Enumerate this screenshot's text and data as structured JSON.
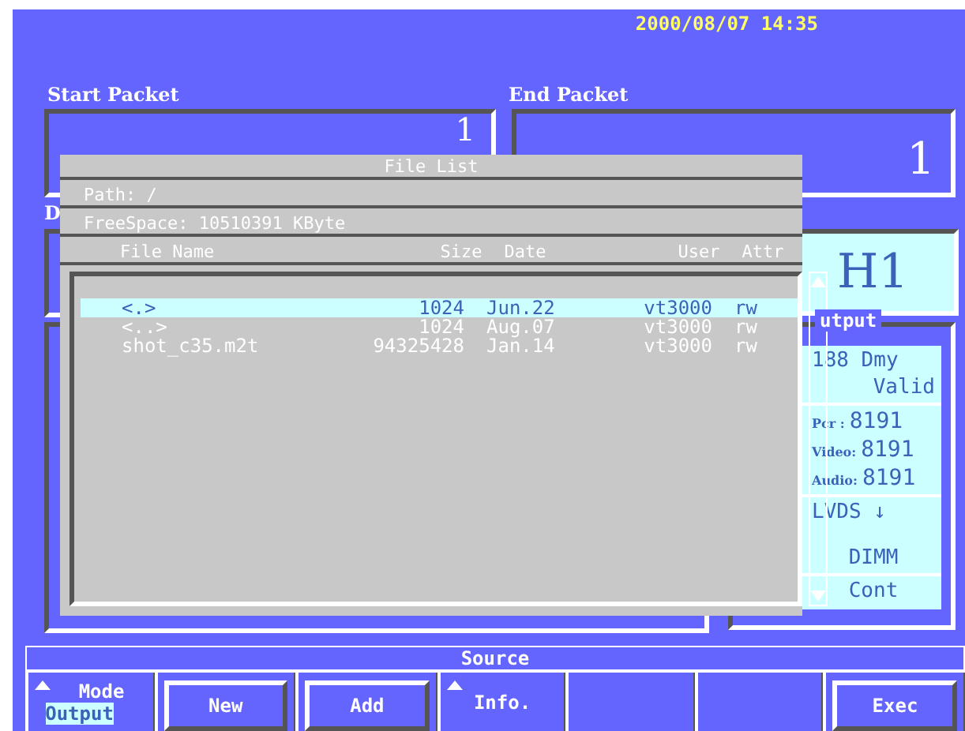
{
  "clock": "2000/08/07 14:35",
  "start_packet": {
    "label": "Start Packet",
    "value": "1"
  },
  "end_packet": {
    "label": "End Packet",
    "value": "1"
  },
  "label_3": "D",
  "channel_field": {
    "value": "H1"
  },
  "output_panel": {
    "label": "utput",
    "sections": [
      [
        {
          "kind": "text",
          "text": "188  Dmy"
        },
        {
          "kind": "text",
          "text": "Valid"
        }
      ],
      [
        {
          "kind": "reading",
          "label": "Pcr  :",
          "text": "8191"
        },
        {
          "kind": "reading",
          "label": "Video:",
          "text": "8191"
        },
        {
          "kind": "reading",
          "label": "Audio:",
          "text": "8191"
        }
      ],
      [
        {
          "kind": "text",
          "text": "LVDS  ↓"
        },
        {
          "kind": "text",
          "text": "DIMM"
        }
      ],
      [
        {
          "kind": "text",
          "text": "Cont"
        }
      ]
    ]
  },
  "file_list": {
    "title": "File List",
    "path": "Path: /",
    "free_space": "FreeSpace: 10510391  KByte",
    "columns": [
      "File Name",
      "Size",
      "Date",
      "User",
      "Attr"
    ],
    "rows": [
      {
        "name": "<.>",
        "size": "1024",
        "date": "Jun.22",
        "user": "vt3000",
        "attr": "rw",
        "selected": true
      },
      {
        "name": "<..>",
        "size": "1024",
        "date": "Aug.07",
        "user": "vt3000",
        "attr": "rw",
        "selected": false
      },
      {
        "name": "shot_c35.m2t",
        "size": "94325428",
        "date": "Jan.14",
        "user": "vt3000",
        "attr": "rw",
        "selected": false
      }
    ]
  },
  "source_bar": {
    "title": "Source",
    "cells": [
      {
        "kind": "selector",
        "label": "Mode",
        "value": "Output"
      },
      {
        "kind": "button",
        "label": "New"
      },
      {
        "kind": "button",
        "label": "Add"
      },
      {
        "kind": "menu",
        "label": "Info."
      },
      {
        "kind": "empty"
      },
      {
        "kind": "empty"
      },
      {
        "kind": "button",
        "label": "Exec"
      }
    ]
  }
}
